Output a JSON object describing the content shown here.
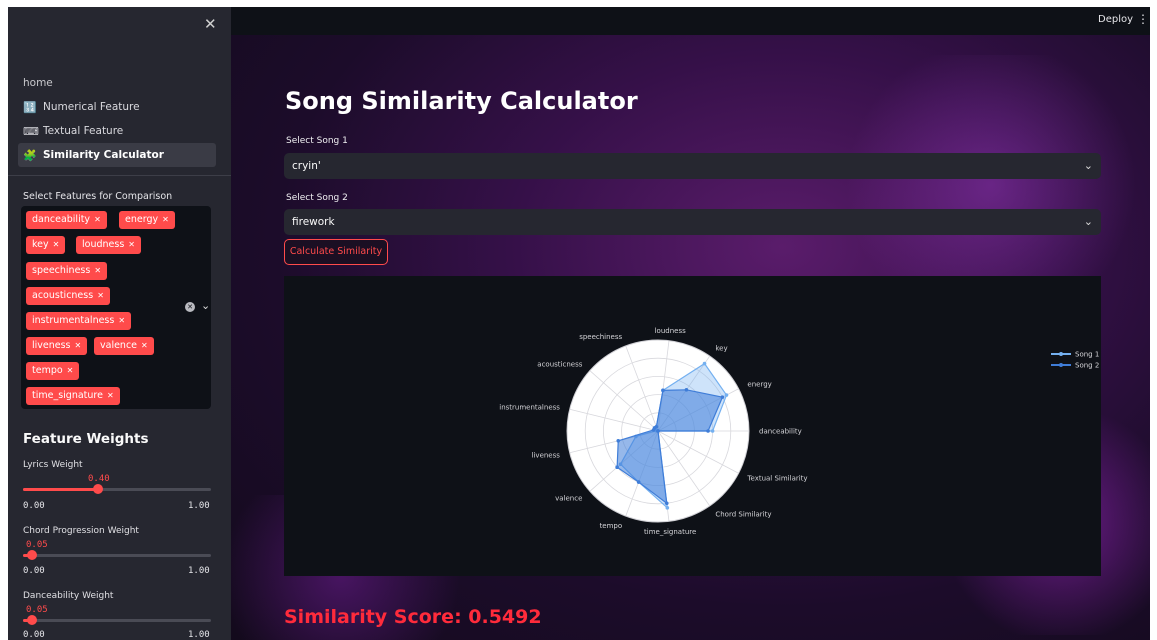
{
  "sidebar": {
    "close_icon": "close-icon",
    "nav": [
      {
        "label": "home",
        "icon": ""
      },
      {
        "label": "Numerical Feature",
        "icon": "numbers-icon"
      },
      {
        "label": "Textual Feature",
        "icon": "keyboard-icon"
      },
      {
        "label": "Similarity Calculator",
        "icon": "puzzle-icon",
        "active": true
      }
    ],
    "features_label": "Select Features for Comparison",
    "selected_features": [
      "danceability",
      "energy",
      "key",
      "loudness",
      "speechiness",
      "acousticness",
      "instrumentalness",
      "liveness",
      "valence",
      "tempo",
      "time_signature"
    ],
    "weights_title": "Feature Weights",
    "sliders": [
      {
        "label": "Lyrics Weight",
        "value": "0.40",
        "fraction": 0.4,
        "min": "0.00",
        "max": "1.00"
      },
      {
        "label": "Chord Progression Weight",
        "value": "0.05",
        "fraction": 0.05,
        "min": "0.00",
        "max": "1.00"
      },
      {
        "label": "Danceability Weight",
        "value": "0.05",
        "fraction": 0.05,
        "min": "0.00",
        "max": "1.00"
      }
    ]
  },
  "header": {
    "deploy_label": "Deploy",
    "menu_icon": "kebab-icon"
  },
  "main": {
    "title": "Song Similarity Calculator",
    "song1_label": "Select Song 1",
    "song1_value": "cryin'",
    "song2_label": "Select Song 2",
    "song2_value": "firework",
    "button_label": "Calculate Similarity",
    "score_text": "Similarity Score: 0.5492"
  },
  "chart_data": {
    "type": "radar",
    "title": "",
    "axes": [
      "danceability",
      "energy",
      "key",
      "loudness",
      "speechiness",
      "acousticness",
      "instrumentalness",
      "liveness",
      "valence",
      "tempo",
      "time_signature",
      "Chord Similarity",
      "Textual Similarity"
    ],
    "range": [
      0,
      1
    ],
    "grid": true,
    "legend_position": "top-right",
    "series": [
      {
        "name": "Song 1",
        "color": "#74b0f0",
        "values": [
          0.6,
          0.85,
          0.9,
          0.45,
          0.05,
          0.05,
          0.02,
          0.25,
          0.55,
          0.6,
          0.85,
          0.0,
          0.0
        ]
      },
      {
        "name": "Song 2",
        "color": "#3f7dd8",
        "values": [
          0.55,
          0.8,
          0.55,
          0.45,
          0.05,
          0.05,
          0.05,
          0.45,
          0.6,
          0.6,
          0.8,
          0.0,
          0.0
        ]
      }
    ]
  }
}
